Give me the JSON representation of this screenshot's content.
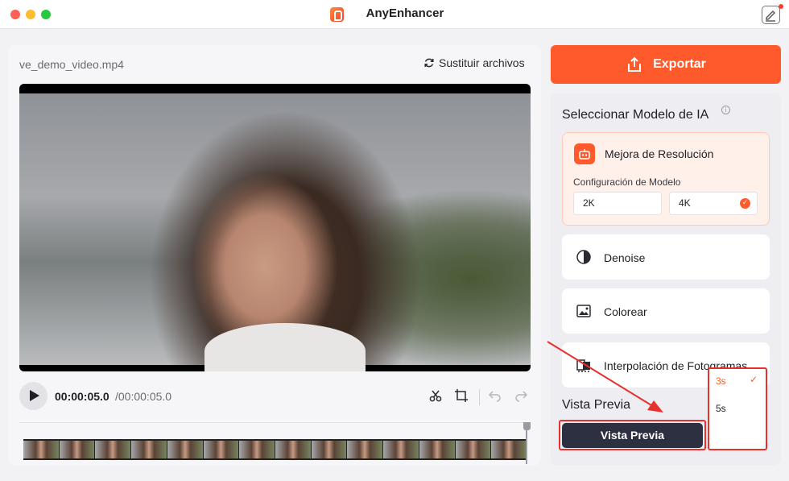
{
  "window": {
    "title": "AnyEnhancer"
  },
  "file": {
    "name": "ve_demo_video.mp4",
    "replace_label": "Sustituir archivos"
  },
  "player": {
    "current_time": "00:00:05.0",
    "total_time": "/00:00:05.0"
  },
  "export": {
    "label": "Exportar"
  },
  "models": {
    "title": "Seleccionar Modelo de IA",
    "info_glyph": "i",
    "items": [
      {
        "label": "Mejora de Resolución",
        "icon": "robot-icon",
        "selected": true
      },
      {
        "label": "Denoise",
        "icon": "denoise-icon",
        "selected": false
      },
      {
        "label": "Colorear",
        "icon": "colorize-icon",
        "selected": false
      },
      {
        "label": "Interpolación de Fotogramas",
        "icon": "interpolation-icon",
        "selected": false
      }
    ],
    "config_label": "Configuración de Modelo",
    "resolutions": [
      {
        "label": "2K",
        "selected": false
      },
      {
        "label": "4K",
        "selected": true
      }
    ],
    "check_glyph": "✓"
  },
  "preview": {
    "title": "Vista Previa",
    "button_label": "Vista Previa",
    "duration_value": "3s",
    "duration_options": [
      {
        "label": "3s",
        "selected": true
      },
      {
        "label": "5s",
        "selected": false
      }
    ],
    "check_glyph": "✓"
  },
  "colors": {
    "accent": "#ff5a2c",
    "dark_button": "#2d3040",
    "annotation_red": "#e8302d"
  }
}
